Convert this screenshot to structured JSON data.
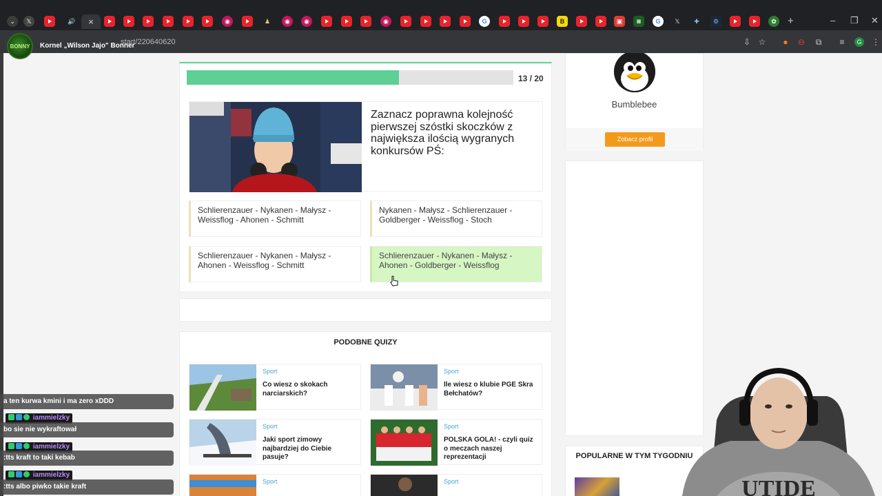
{
  "browser": {
    "active_tab_close": "×",
    "url": "start/220640620",
    "new_tab": "+",
    "window_controls": [
      "–",
      "❐",
      "✕"
    ]
  },
  "stream": {
    "channel_name": "Kornel „Wilson Jajo\" Bonner",
    "logo_text": "BONNY"
  },
  "quiz": {
    "progress_current": 13,
    "progress_total": 20,
    "progress_label": "13 / 20",
    "question": "Zaznacz poprawna kolejność pierwszej szóstki skoczków z największa ilością wygranych konkursów PŚ:",
    "answers": [
      {
        "text": "Schlierenzauer - Nykanen - Małysz - Weissflog - Ahonen - Schmitt",
        "selected": false
      },
      {
        "text": "Nykanen - Małysz - Schlierenzauer - Goldberger - Weissflog - Stoch",
        "selected": false
      },
      {
        "text": "Schlierenzauer - Nykanen - Małysz - Ahonen - Weissflog - Schmitt",
        "selected": false
      },
      {
        "text": "Schlierenzauer - Nykanen - Małysz - Ahonen - Goldberger - Weissflog",
        "selected": true
      }
    ]
  },
  "similar": {
    "title": "PODOBNE QUIZY",
    "items": [
      {
        "category": "Sport",
        "title": "Co wiesz o skokach narciarskich?"
      },
      {
        "category": "Sport",
        "title": "Ile wiesz o klubie PGE Skra Bełchatów?"
      },
      {
        "category": "Sport",
        "title": "Jaki sport zimowy najbardziej do Ciebie pasuje?"
      },
      {
        "category": "Sport",
        "title": "POLSKA GOLA! - czyli quiz o meczach naszej reprezentacji"
      },
      {
        "category": "Sport",
        "title": ""
      },
      {
        "category": "Sport",
        "title": ""
      }
    ]
  },
  "sidebar": {
    "profile_name": "Bumblebee",
    "profile_button": "Zobacz profil",
    "popular_title": "POPULARNE W TYM TYGODNIU"
  },
  "chat": {
    "messages": [
      {
        "user": "",
        "text": "a ten kurwa kmini i ma zero xDDD"
      },
      {
        "user": "iammielzky",
        "text": "bo sie nie wykraftował"
      },
      {
        "user": "iammielzky",
        "text": ":tts kraft to taki kebab"
      },
      {
        "user": "iammielzky",
        "text": ":tts albo piwko takie kraft"
      }
    ]
  },
  "colors": {
    "progress": "#5ecf95",
    "selected_answer": "#d6f6c4",
    "category": "#4aa3d8",
    "profile_button": "#f39a1c",
    "chat_user": "#b98cff"
  }
}
